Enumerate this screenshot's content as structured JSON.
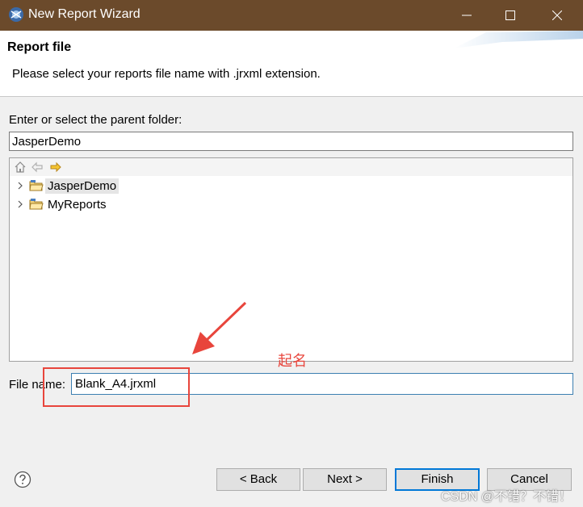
{
  "window": {
    "title": "New Report Wizard",
    "controls": [
      "minimize-icon",
      "maximize-icon",
      "close-icon"
    ],
    "titlebar_color": "#6b4a2b"
  },
  "header": {
    "title": "Report file",
    "description": "Please select your reports file name with .jrxml extension."
  },
  "folder": {
    "label": "Enter or select the parent folder:",
    "value": "JasperDemo"
  },
  "tree": {
    "toolbar_icons": [
      "home-icon",
      "back-arrow-icon",
      "forward-arrow-icon"
    ],
    "items": [
      {
        "label": "JasperDemo",
        "selected": true
      },
      {
        "label": "MyReports",
        "selected": false
      }
    ]
  },
  "annotation": {
    "note": "起名",
    "color": "#e8453c"
  },
  "file": {
    "label": "File name:",
    "value": "Blank_A4.jrxml"
  },
  "buttons": {
    "back": "< Back",
    "next": "Next >",
    "finish": "Finish",
    "cancel": "Cancel"
  },
  "watermark": "CSDN @不错？不错！"
}
